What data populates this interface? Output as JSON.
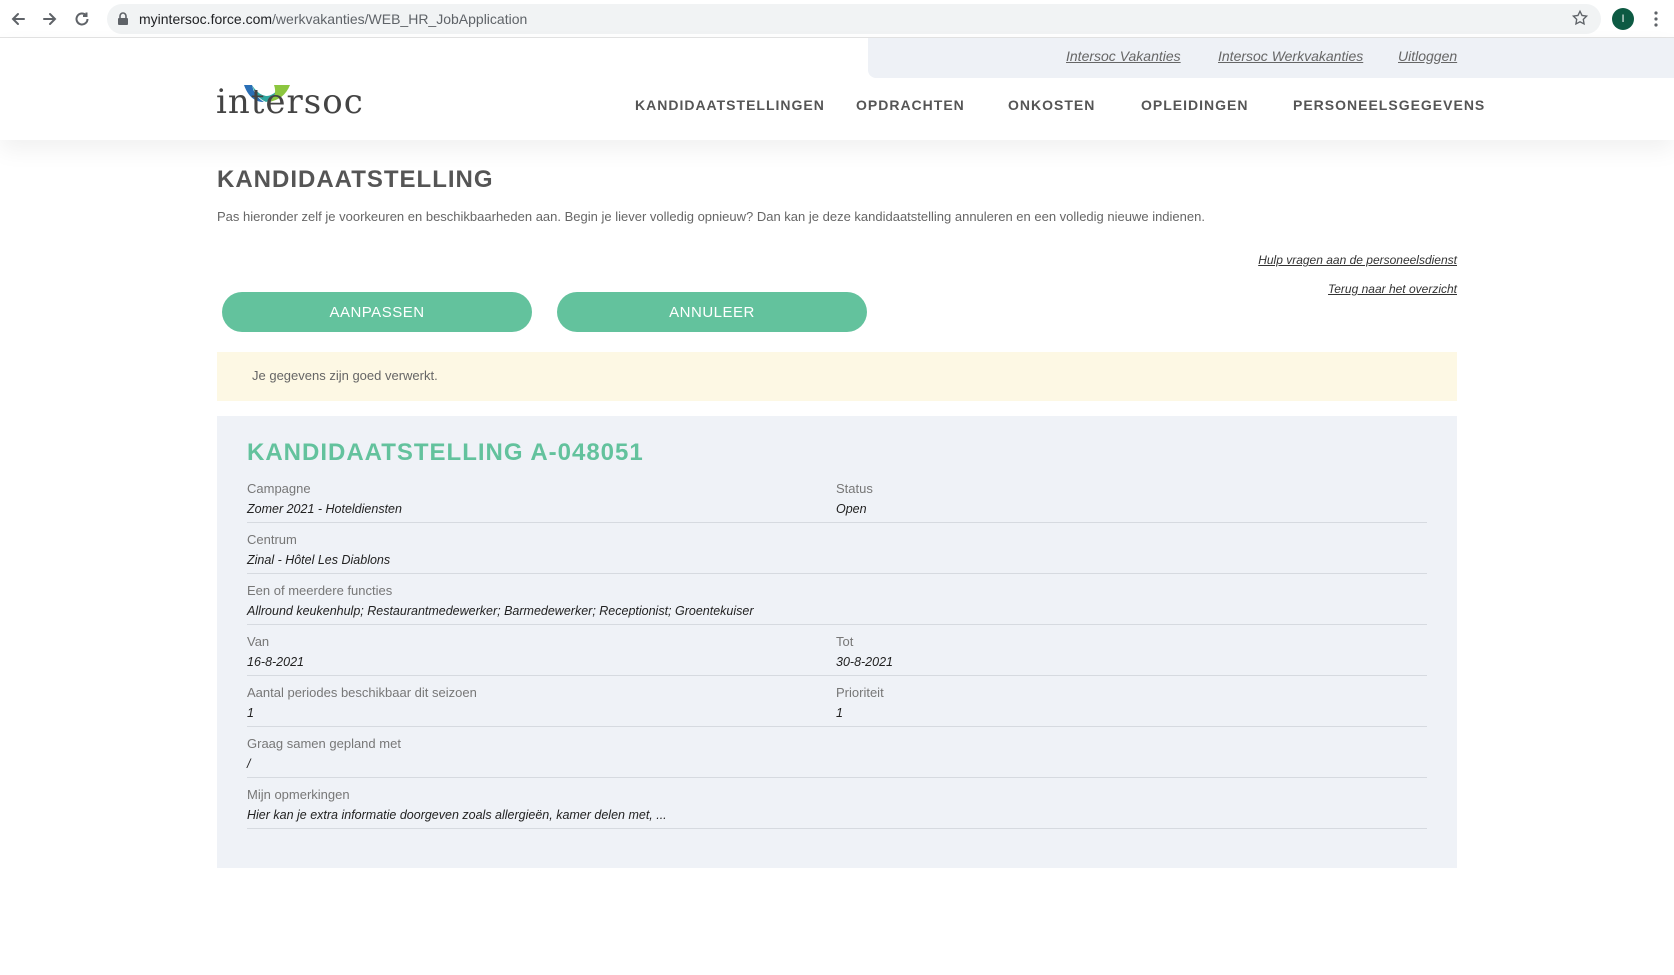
{
  "browser": {
    "url_domain": "myintersoc.force.com",
    "url_path": "/werkvakanties/WEB_HR_JobApplication",
    "profile_initial": "I"
  },
  "header": {
    "logo_text": "intersoc",
    "utility_links": [
      "Intersoc Vakanties",
      "Intersoc Werkvakanties",
      "Uitloggen"
    ],
    "nav": [
      "KANDIDAATSTELLINGEN",
      "OPDRACHTEN",
      "ONKOSTEN",
      "OPLEIDINGEN",
      "PERSONEELSGEGEVENS"
    ]
  },
  "page": {
    "title": "KANDIDAATSTELLING",
    "intro": "Pas hieronder zelf je voorkeuren en beschikbaarheden aan. Begin je liever volledig opnieuw? Dan kan je deze kandidaatstelling annuleren en een volledig nieuwe indienen.",
    "help_link": "Hulp vragen aan de personeelsdienst",
    "back_link": "Terug naar het overzicht",
    "edit_button": "AANPASSEN",
    "cancel_button": "ANNULEER",
    "notice": "Je gegevens zijn goed verwerkt."
  },
  "card": {
    "title": "KANDIDAATSTELLING A-048051",
    "fields": {
      "campagne": {
        "label": "Campagne",
        "value": "Zomer 2021 - Hoteldiensten"
      },
      "status": {
        "label": "Status",
        "value": "Open"
      },
      "centrum": {
        "label": "Centrum",
        "value": "Zinal - Hôtel Les Diablons"
      },
      "functies": {
        "label": "Een of meerdere functies",
        "value": "Allround keukenhulp; Restaurantmedewerker; Barmedewerker; Receptionist; Groentekuiser"
      },
      "van": {
        "label": "Van",
        "value": "16-8-2021"
      },
      "tot": {
        "label": "Tot",
        "value": "30-8-2021"
      },
      "periodes": {
        "label": "Aantal periodes beschikbaar dit seizoen",
        "value": "1"
      },
      "prioriteit": {
        "label": "Prioriteit",
        "value": "1"
      },
      "samen": {
        "label": "Graag samen gepland met",
        "value": "/"
      },
      "opmerkingen": {
        "label": "Mijn opmerkingen",
        "value": "Hier kan je extra informatie doorgeven zoals allergieën, kamer delen met, ..."
      }
    }
  },
  "colors": {
    "accent": "#63c29d",
    "notice_bg": "#fdf8e4",
    "card_bg": "#eff2f7"
  }
}
